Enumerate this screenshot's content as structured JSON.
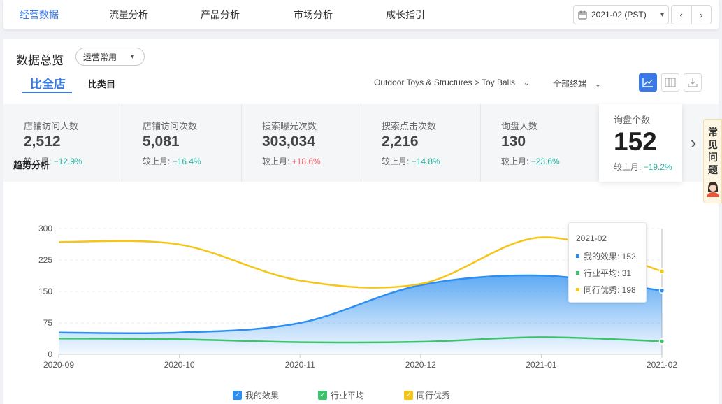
{
  "nav": {
    "tabs": [
      "经营数据",
      "流量分析",
      "产品分析",
      "市场分析",
      "成长指引"
    ],
    "date": "2021-02 (PST)"
  },
  "overview": {
    "title": "数据总览",
    "mode": "运营常用",
    "tab_all": "比全店",
    "tab_category": "比类目",
    "category_path": "Outdoor Toys & Structures > Toy Balls",
    "terminal": "全部终端"
  },
  "metrics": [
    {
      "label": "店铺访问人数",
      "value": "2,512",
      "cmp_label": "较上月:",
      "change": "−12.9%",
      "dir": "down"
    },
    {
      "label": "店铺访问次数",
      "value": "5,081",
      "cmp_label": "较上月:",
      "change": "−16.4%",
      "dir": "down"
    },
    {
      "label": "搜索曝光次数",
      "value": "303,034",
      "cmp_label": "较上月:",
      "change": "+18.6%",
      "dir": "up"
    },
    {
      "label": "搜索点击次数",
      "value": "2,216",
      "cmp_label": "较上月:",
      "change": "−14.8%",
      "dir": "down"
    },
    {
      "label": "询盘人数",
      "value": "130",
      "cmp_label": "较上月:",
      "change": "−23.6%",
      "dir": "down"
    },
    {
      "label": "询盘个数",
      "value": "152",
      "cmp_label": "较上月:",
      "change": "−19.2%",
      "dir": "down"
    }
  ],
  "faq": {
    "label": "常见问题"
  },
  "trend": {
    "title": "趋势分析"
  },
  "tooltip": {
    "title": "2021-02",
    "rows": [
      "我的效果: 152",
      "行业平均: 31",
      "同行优秀: 198"
    ]
  },
  "colors": {
    "mine": "#2b8ef0",
    "industry": "#3cc36b",
    "peer": "#f5c518",
    "accent": "#3a79e8"
  },
  "chart_data": {
    "type": "line",
    "x": [
      "2020-09",
      "2020-10",
      "2020-11",
      "2020-12",
      "2021-01",
      "2021-02"
    ],
    "yticks": [
      0,
      75,
      150,
      225,
      300
    ],
    "ylim": [
      0,
      300
    ],
    "series": [
      {
        "name": "我的效果",
        "values": [
          52,
          52,
          75,
          165,
          188,
          152
        ],
        "color": "#2b8ef0",
        "area": true
      },
      {
        "name": "行业平均",
        "values": [
          38,
          36,
          29,
          30,
          41,
          31
        ],
        "color": "#3cc36b"
      },
      {
        "name": "同行优秀",
        "values": [
          268,
          262,
          176,
          168,
          279,
          198
        ],
        "color": "#f5c518"
      }
    ]
  }
}
